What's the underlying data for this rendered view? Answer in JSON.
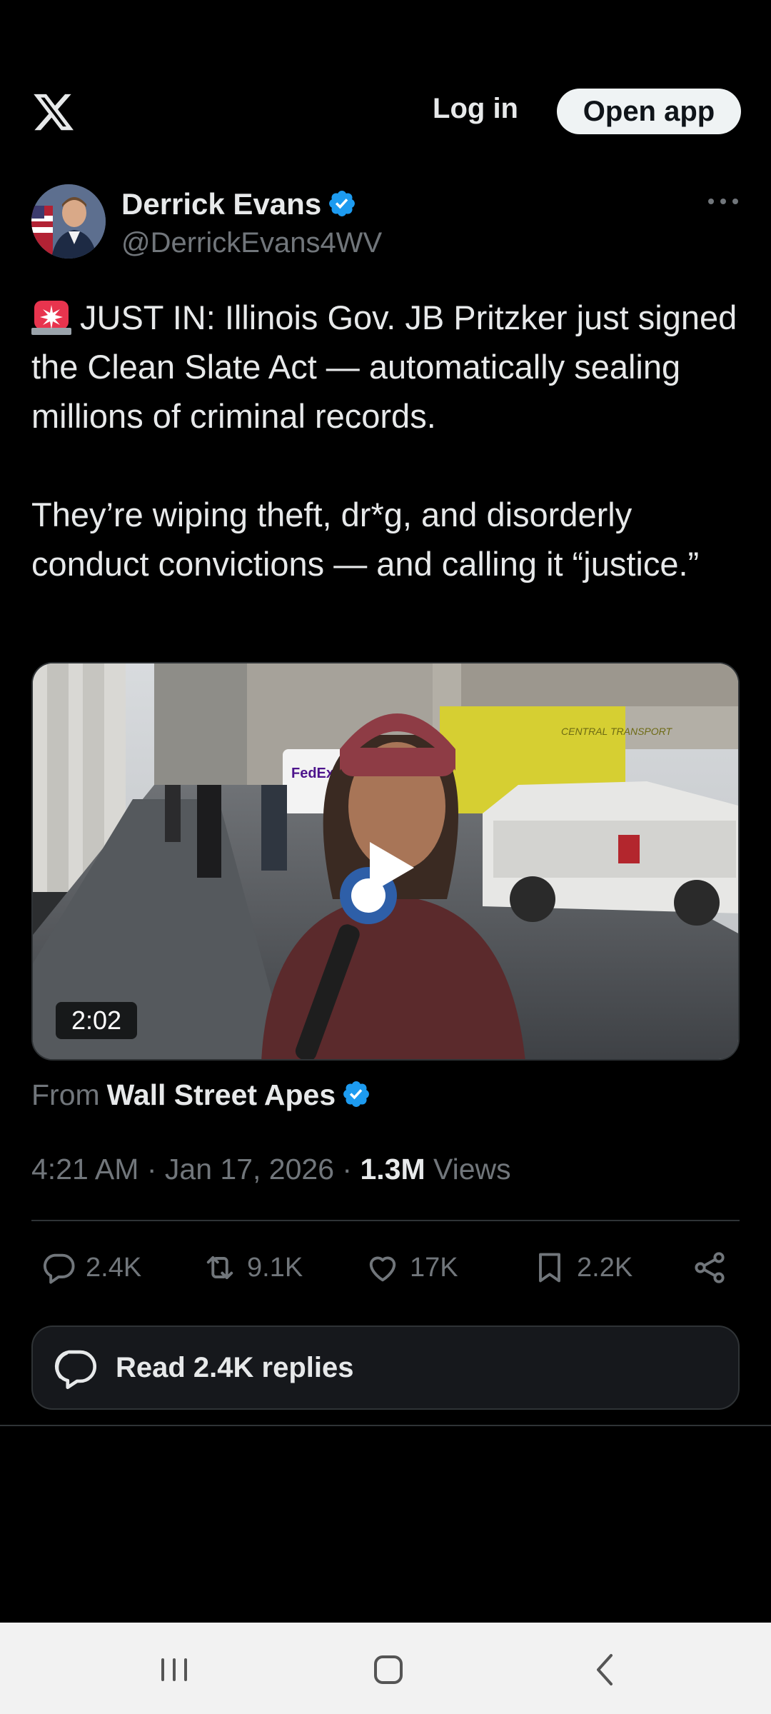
{
  "topbar": {
    "logo_icon": "x-logo-icon",
    "login_label": "Log in",
    "open_app_label": "Open app"
  },
  "author": {
    "name": "Derrick Evans",
    "handle": "@DerrickEvans4WV",
    "verified_icon": "verified-badge-icon",
    "more_icon": "more-options-icon"
  },
  "tweet": {
    "emoji_icon": "siren-icon",
    "paragraph1": "JUST IN: Illinois Gov. JB Pritzker just signed the Clean Slate Act — automatically sealing millions of criminal records.",
    "paragraph2": "They’re wiping theft, dr*g, and disorderly conduct convictions — and calling it “justice.”"
  },
  "video": {
    "duration": "2:02",
    "play_icon": "play-icon",
    "scene_text": [
      "FedEx",
      "CENTRAL TRANSPORT"
    ]
  },
  "source": {
    "prefix": "From",
    "name": "Wall Street Apes"
  },
  "meta": {
    "time": "4:21 AM",
    "separator": "·",
    "date": "Jan 17, 2026",
    "views_count": "1.3M",
    "views_label": "Views"
  },
  "actions": {
    "replies": "2.4K",
    "reposts": "9.1K",
    "likes": "17K",
    "bookmarks": "2.2K"
  },
  "read_replies_label": "Read 2.4K replies",
  "colors": {
    "background": "#000000",
    "text_primary": "#e7e9ea",
    "text_secondary": "#71767b",
    "verified_blue": "#1d9bf0",
    "divider": "#2f3336"
  }
}
